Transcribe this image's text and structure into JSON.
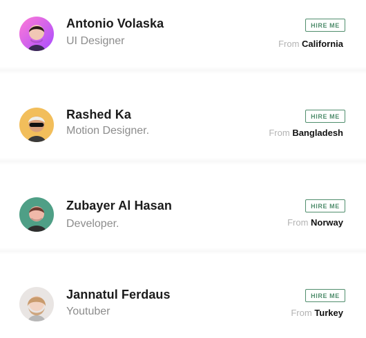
{
  "people": [
    {
      "name": "Antonio Volaska",
      "role": "UI Designer",
      "hire_label": "HIRE ME",
      "from_label": "From",
      "location": "California",
      "avatar": {
        "bg": "#d96ac7",
        "skin": "#f1c7b5",
        "hair": "#2a1b1b",
        "shirt": "#3b2a56"
      }
    },
    {
      "name": "Rashed Ka",
      "role": "Motion Designer.",
      "hire_label": "HIRE ME",
      "from_label": "From",
      "location": "Bangladesh",
      "avatar": {
        "bg": "#f2be5b",
        "skin": "#d9a07b",
        "hair": "#f0efe8",
        "shirt": "#3a3a3a"
      }
    },
    {
      "name": "Zubayer Al Hasan",
      "role": "Developer.",
      "hire_label": "HIRE ME",
      "from_label": "From",
      "location": "Norway",
      "avatar": {
        "bg": "#4f9f86",
        "skin": "#f0b9a9",
        "hair": "#6d3a2f",
        "shirt": "#2e2e2e"
      }
    },
    {
      "name": "Jannatul Ferdaus",
      "role": "Youtuber",
      "hire_label": "HIRE ME",
      "from_label": "From",
      "location": "Turkey",
      "avatar": {
        "bg": "#e9e5e3",
        "skin": "#f2d3c2",
        "hair": "#c99b6d",
        "shirt": "#b7b7b7"
      }
    }
  ],
  "colors": {
    "accent": "#4f8d6c",
    "name": "#1b1b1b",
    "role": "#8c8c8c",
    "from_muted": "#b3b3b3",
    "location": "#111111"
  }
}
